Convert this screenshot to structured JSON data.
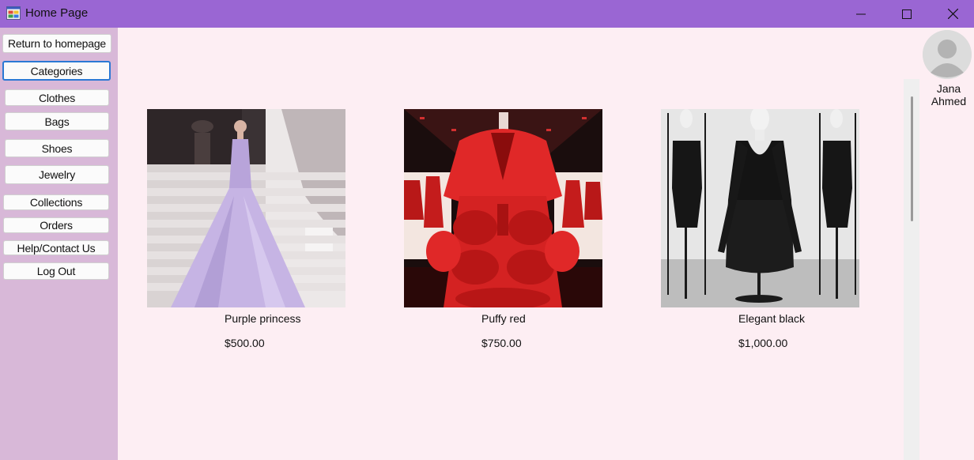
{
  "window": {
    "title": "Home Page",
    "controls": [
      "minimize-icon",
      "maximize-icon",
      "close-icon"
    ]
  },
  "sidebar": {
    "return_home": "Return to homepage",
    "categories": "Categories",
    "category_items": [
      "Clothes",
      "Bags",
      "Shoes",
      "Jewelry"
    ],
    "collections": "Collections",
    "orders": "Orders",
    "help": "Help/Contact Us",
    "logout": "Log Out"
  },
  "products": [
    {
      "name": "Purple princess",
      "price": "$500.00",
      "image": "lavender-gown-photo"
    },
    {
      "name": "Puffy red",
      "price": "$750.00",
      "image": "red-fur-coat-photo"
    },
    {
      "name": "Elegant black",
      "price": "$1,000.00",
      "image": "black-dresses-photo"
    }
  ],
  "user": {
    "first_name": "Jana",
    "last_name": "Ahmed",
    "avatar_icon": "user-avatar-icon"
  },
  "colors": {
    "titlebar": "#9a66d3",
    "sidebar": "#d8b8d8",
    "background": "#fdeef3",
    "focus_border": "#2a78d4"
  }
}
